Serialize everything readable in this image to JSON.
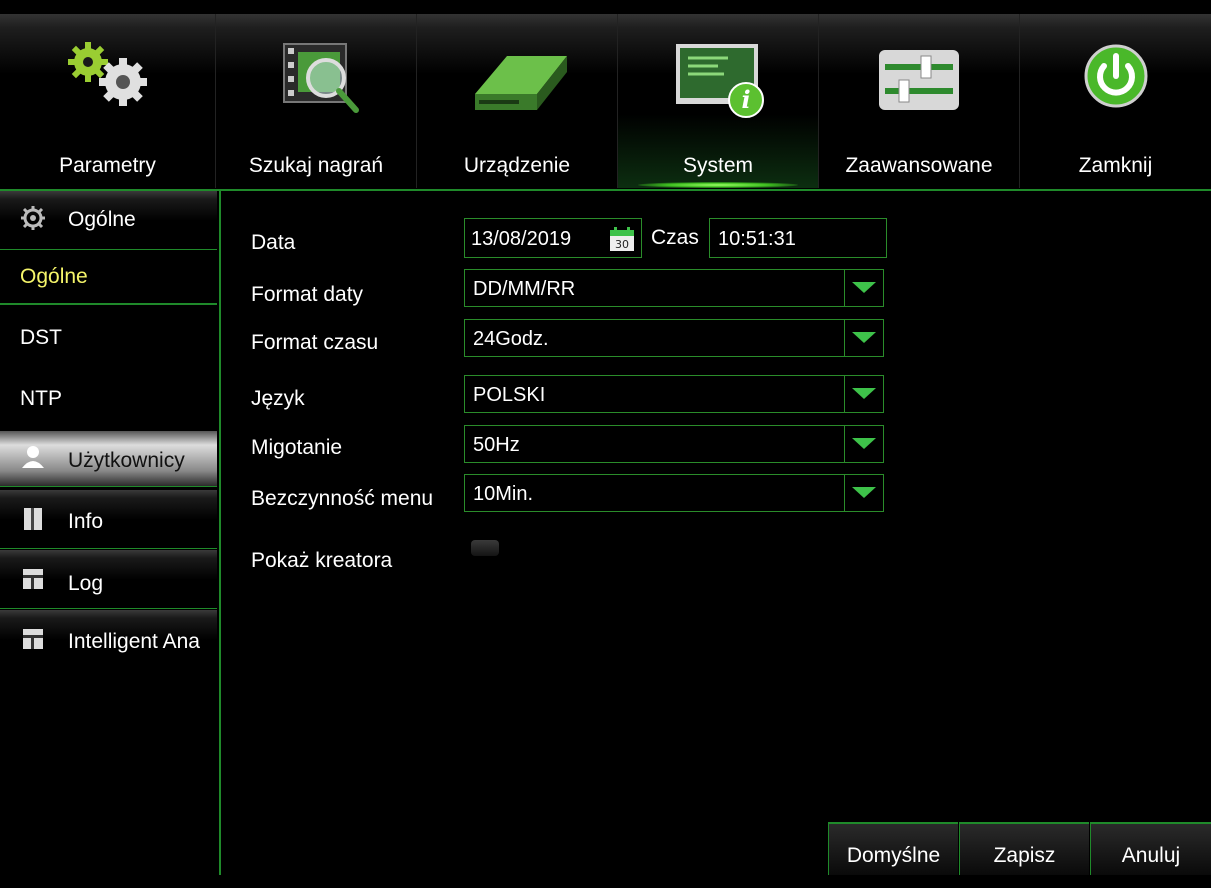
{
  "tabs": [
    {
      "label": "Parametry",
      "icon": "gears-icon"
    },
    {
      "label": "Szukaj nagrań",
      "icon": "film-search-icon"
    },
    {
      "label": "Urządzenie",
      "icon": "hard-drive-icon"
    },
    {
      "label": "System",
      "icon": "monitor-info-icon"
    },
    {
      "label": "Zaawansowane",
      "icon": "sliders-icon"
    },
    {
      "label": "Zamknij",
      "icon": "power-icon"
    }
  ],
  "active_tab": "System",
  "sidebar": {
    "sections": [
      {
        "label": "Ogólne",
        "icon": "gear-icon"
      },
      {
        "label": "Użytkownicy",
        "icon": "user-icon"
      },
      {
        "label": "Info",
        "icon": "info-book-icon"
      },
      {
        "label": "Log",
        "icon": "log-icon"
      },
      {
        "label": "Intelligent Ana",
        "icon": "analytics-icon"
      }
    ],
    "items": [
      {
        "label": "Ogólne",
        "active": true
      },
      {
        "label": "DST",
        "active": false
      },
      {
        "label": "NTP",
        "active": false
      }
    ]
  },
  "form": {
    "date_label": "Data",
    "date_value": "13/08/2019",
    "calendar_day": "30",
    "time_label": "Czas",
    "time_value": "10:51:31",
    "date_format_label": "Format daty",
    "date_format_value": "DD/MM/RR",
    "time_format_label": "Format czasu",
    "time_format_value": "24Godz.",
    "language_label": "Język",
    "language_value": "POLSKI",
    "flicker_label": "Migotanie",
    "flicker_value": "50Hz",
    "menu_timeout_label": "Bezczynność menu",
    "menu_timeout_value": "10Min.",
    "wizard_label": "Pokaż kreatora",
    "wizard_checked": false
  },
  "buttons": {
    "default_label": "Domyślne",
    "save_label": "Zapisz",
    "cancel_label": "Anuluj"
  },
  "colors": {
    "accent": "#1f8a2a",
    "active_text": "#f5f56a",
    "dropdown_arrow": "#3ec24a"
  }
}
